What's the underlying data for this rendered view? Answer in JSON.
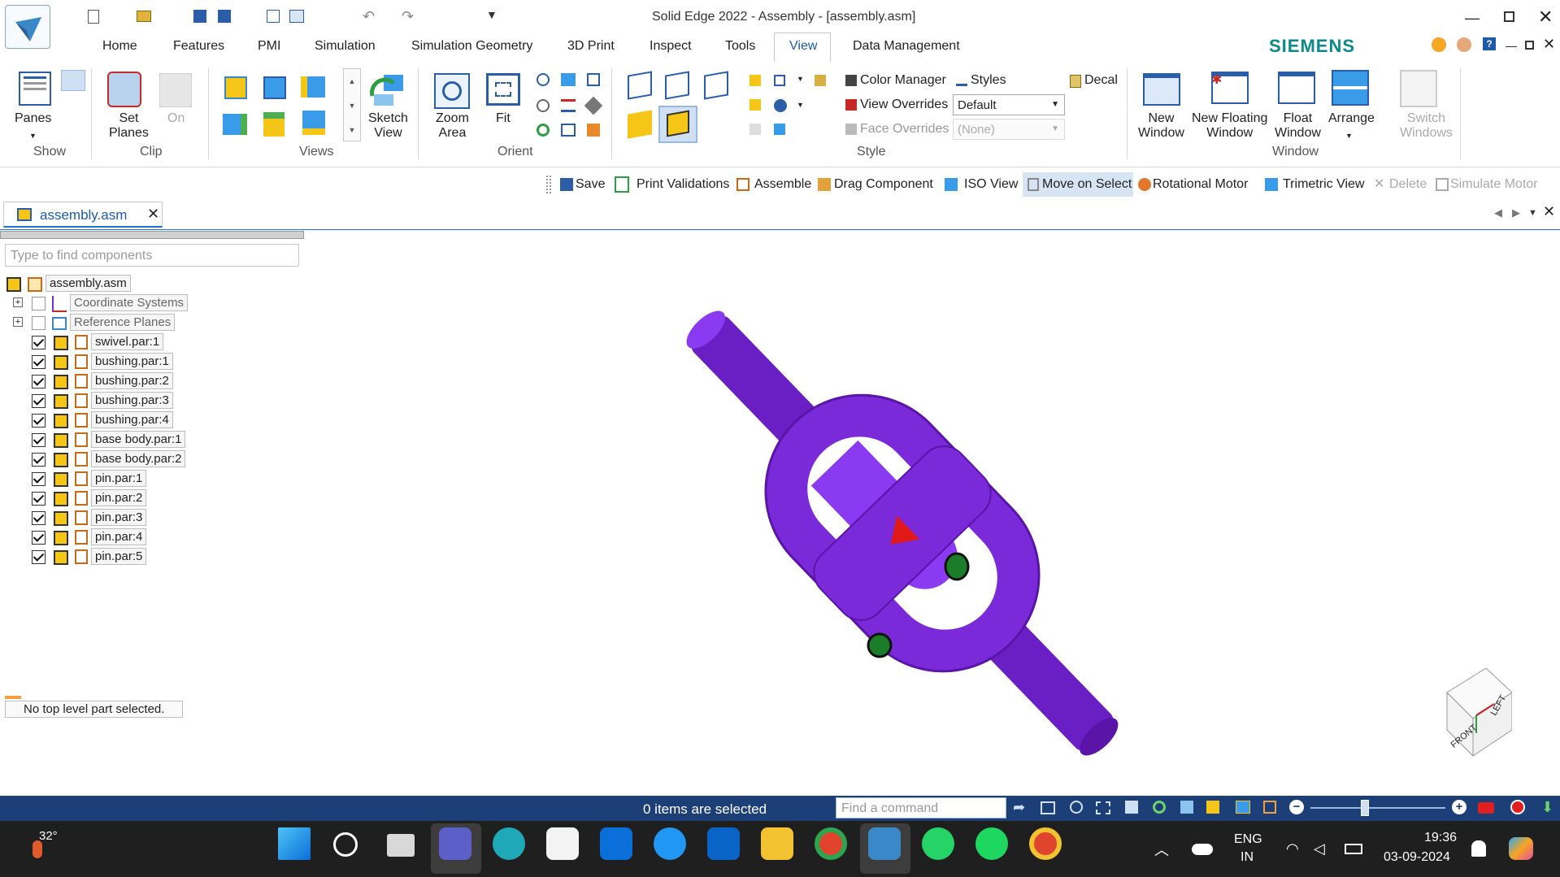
{
  "title": "Solid Edge 2022 - Assembly - [assembly.asm]",
  "brand": "SIEMENS",
  "tabs": [
    "Home",
    "Features",
    "PMI",
    "Simulation",
    "Simulation Geometry",
    "3D Print",
    "Inspect",
    "Tools",
    "View",
    "Data Management"
  ],
  "ribbon": {
    "panes": "Panes",
    "show": "Show",
    "set": "Set",
    "planes": "Planes",
    "on": "On",
    "clip": "Clip",
    "views": "Views",
    "sketch": "Sketch",
    "view": "View",
    "zoom": "Zoom",
    "area": "Area",
    "fit": "Fit",
    "orient": "Orient",
    "color_manager": "Color Manager",
    "styles": "Styles",
    "decal": "Decal",
    "view_overrides": "View Overrides",
    "view_overrides_value": "Default",
    "face_overrides": "Face Overrides",
    "face_overrides_value": "(None)",
    "style": "Style",
    "new": "New",
    "window": "Window",
    "new_floating": "New Floating",
    "float": "Float",
    "arrange": "Arrange",
    "switch": "Switch",
    "windows": "Windows",
    "window_group": "Window"
  },
  "quick_commands": [
    "Save",
    "Print Validations",
    "Assemble",
    "Drag Component",
    "ISO View",
    "Move on Select",
    "Rotational Motor",
    "Trimetric View",
    "Delete",
    "Simulate Motor"
  ],
  "doc_tab": "assembly.asm",
  "pathfinder": {
    "search_placeholder": "Type to find components",
    "root": "assembly.asm",
    "items": [
      "Coordinate Systems",
      "Reference Planes",
      "swivel.par:1",
      "bushing.par:1",
      "bushing.par:2",
      "bushing.par:3",
      "bushing.par:4",
      "base body.par:1",
      "base body.par:2",
      "pin.par:1",
      "pin.par:2",
      "pin.par:3",
      "pin.par:4",
      "pin.par:5"
    ],
    "status": "No top level part selected."
  },
  "viewcube": {
    "front": "FRONT",
    "left": "LEFT"
  },
  "statusbar": {
    "selection": "0 items are selected",
    "find_placeholder": "Find a command"
  },
  "taskbar": {
    "temp": "32°",
    "lang1": "ENG",
    "lang2": "IN",
    "time": "19:36",
    "date": "03-09-2024"
  },
  "colors": {
    "model": "#7a2ad8",
    "statusbar": "#1c3f78",
    "taskbar": "#1f1f1f",
    "accent": "#1e73c8"
  }
}
